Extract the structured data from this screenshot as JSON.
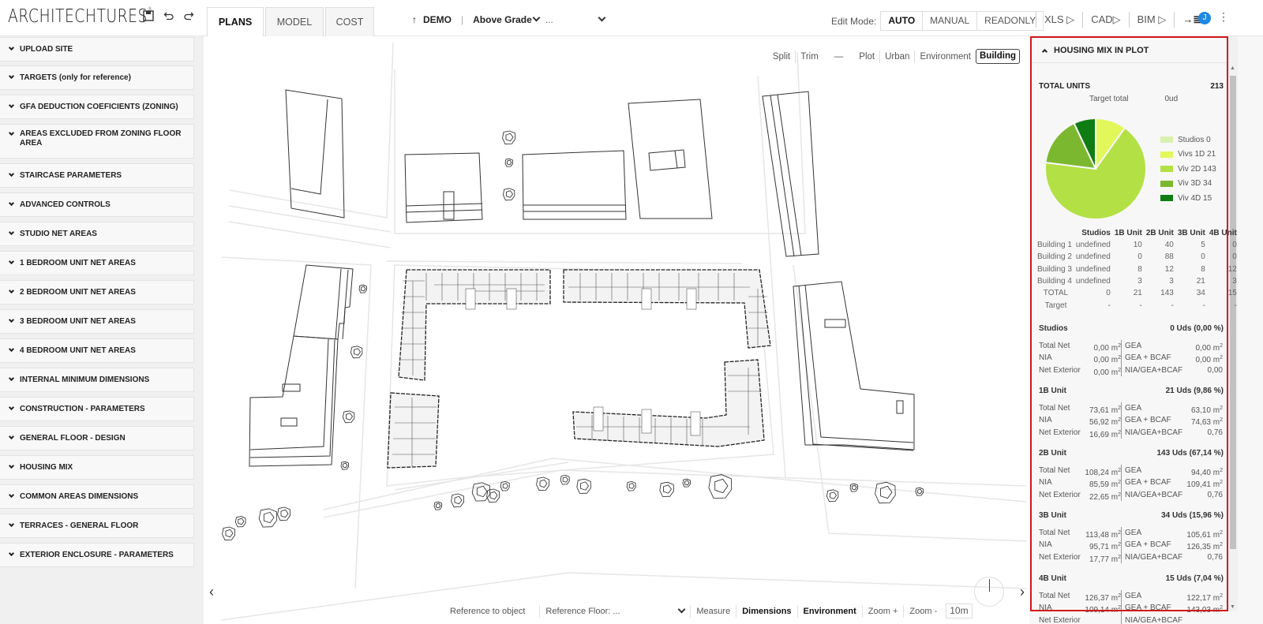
{
  "app": {
    "logo": "ARCHITECHTURES",
    "toolbar_icons": [
      "save-icon",
      "undo-icon",
      "redo-icon"
    ]
  },
  "tabs": [
    {
      "label": "PLANS",
      "active": true
    },
    {
      "label": "MODEL",
      "active": false
    },
    {
      "label": "COST",
      "active": false
    }
  ],
  "project": {
    "up_arrow": "↑",
    "name": "DEMO",
    "separator": "|",
    "level": "Above Grade",
    "more": "..."
  },
  "edit_mode": {
    "label": "Edit Mode:",
    "options": [
      "AUTO",
      "MANUAL",
      "READONLY"
    ],
    "selected": "AUTO"
  },
  "exports": [
    {
      "label": "XLS ▷"
    },
    {
      "label": "CAD▷"
    },
    {
      "label": "BIM ▷"
    },
    {
      "label": "→≣"
    }
  ],
  "user": {
    "initial": "J",
    "menu_glyph": "⋮"
  },
  "sidebar": {
    "sections": [
      "UPLOAD SITE",
      "TARGETS (only for reference)",
      "GFA DEDUCTION COEFICIENTS (ZONING)",
      "AREAS EXCLUDED FROM ZONING FLOOR AREA",
      "STAIRCASE PARAMETERS",
      "ADVANCED CONTROLS",
      "STUDIO NET AREAS",
      "1 BEDROOM UNIT NET AREAS",
      "2 BEDROOM UNIT NET AREAS",
      "3 BEDROOM UNIT NET AREAS",
      "4 BEDROOM UNIT NET AREAS",
      "INTERNAL MINIMUM DIMENSIONS",
      "CONSTRUCTION - PARAMETERS",
      "GENERAL FLOOR - DESIGN",
      "HOUSING MIX",
      "COMMON AREAS DIMENSIONS",
      "TERRACES - GENERAL FLOOR",
      "EXTERIOR ENCLOSURE - PARAMETERS"
    ]
  },
  "canvas": {
    "view_options": [
      "Split",
      "Trim",
      "—",
      "Plot",
      "Urban",
      "Environment",
      "Building"
    ],
    "view_selected": "Building",
    "bottom": {
      "reference_object": "Reference to object",
      "reference_floor_label": "Reference Floor:",
      "reference_floor_value": "...",
      "measure": "Measure",
      "dimensions": "Dimensions",
      "environment": "Environment",
      "zoom_in": "Zoom +",
      "zoom_out": "Zoom -",
      "scale": "10m"
    },
    "prev_arrow": "‹",
    "next_arrow": "›"
  },
  "housing_mix": {
    "title": "HOUSING MIX IN PLOT",
    "total_units_label": "TOTAL UNITS",
    "total_units": "213",
    "target_total_label": "Target total",
    "target_total_value": "0ud",
    "legend": [
      {
        "label": "Studios 0",
        "value": 0,
        "color": "#d9f0b0"
      },
      {
        "label": "Vivs 1D 21",
        "value": 21,
        "color": "#e2f85a"
      },
      {
        "label": "Viv 2D 143",
        "value": 143,
        "color": "#b3e044"
      },
      {
        "label": "Viv 3D 34",
        "value": 34,
        "color": "#7cb82f"
      },
      {
        "label": "Viv 4D 15",
        "value": 15,
        "color": "#0f7d14"
      }
    ],
    "table": {
      "headers": [
        "",
        "Studios",
        "1B Unit",
        "2B Unit",
        "3B Unit",
        "4B Unit"
      ],
      "rows": [
        [
          "Building 1",
          "undefined",
          "10",
          "40",
          "5",
          "0"
        ],
        [
          "Building 2",
          "undefined",
          "0",
          "88",
          "0",
          "0"
        ],
        [
          "Building 3",
          "undefined",
          "8",
          "12",
          "8",
          "12"
        ],
        [
          "Building 4",
          "undefined",
          "3",
          "3",
          "21",
          "3"
        ],
        [
          "TOTAL",
          "0",
          "21",
          "143",
          "34",
          "15"
        ],
        [
          "Target",
          "-",
          "-",
          "-",
          "-",
          "-"
        ]
      ]
    },
    "unit_sections": [
      {
        "name": "Studios",
        "summary": "0 Uds (0,00 %)",
        "total_net": "0,00 m",
        "nia": "0,00 m",
        "net_exterior": "0,00 m",
        "gea": "0,00 m",
        "gea_bcaf": "0,00 m",
        "ratio": "0,00"
      },
      {
        "name": "1B Unit",
        "summary": "21 Uds (9,86 %)",
        "total_net": "73,61 m",
        "nia": "56,92 m",
        "net_exterior": "16,69 m",
        "gea": "63,10 m",
        "gea_bcaf": "74,63 m",
        "ratio": "0,76"
      },
      {
        "name": "2B Unit",
        "summary": "143 Uds (67,14 %)",
        "total_net": "108,24 m",
        "nia": "85,59 m",
        "net_exterior": "22,65 m",
        "gea": "94,40 m",
        "gea_bcaf": "109,41 m",
        "ratio": "0,76"
      },
      {
        "name": "3B Unit",
        "summary": "34 Uds (15,96 %)",
        "total_net": "113,48 m",
        "nia": "95,71 m",
        "net_exterior": "17,77 m",
        "gea": "105,61 m",
        "gea_bcaf": "126,35 m",
        "ratio": "0,76"
      },
      {
        "name": "4B Unit",
        "summary": "15 Uds (7,04 %)",
        "total_net": "126,37 m",
        "nia": "109,14 m",
        "net_exterior": "",
        "gea": "122,17 m",
        "gea_bcaf": "143,03 m",
        "ratio": ""
      }
    ],
    "row_labels": {
      "total_net": "Total Net",
      "nia": "NIA",
      "net_exterior": "Net Exterior",
      "gea": "GEA",
      "gea_bcaf": "GEA + BCAF",
      "ratio": "NIA/GEA+BCAF",
      "sq": "2"
    }
  }
}
